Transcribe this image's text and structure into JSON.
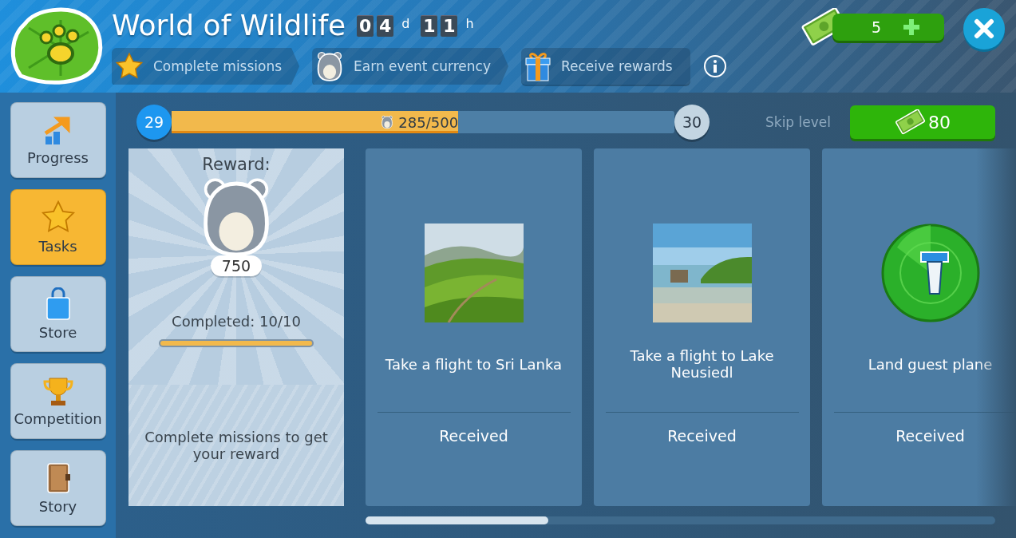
{
  "header": {
    "title": "World of Wildlife",
    "timer": [
      {
        "digits": [
          "0",
          "4"
        ],
        "unit": "d"
      },
      {
        "digits": [
          "1",
          "1"
        ],
        "unit": "h"
      }
    ],
    "steps": [
      {
        "kind": "star",
        "label": "Complete missions"
      },
      {
        "kind": "hamster",
        "label": "Earn event currency"
      },
      {
        "kind": "gift",
        "label": "Receive rewards"
      }
    ],
    "currency": {
      "amount": "5"
    }
  },
  "sidebar": {
    "items": [
      {
        "kind": "progress",
        "label": "Progress",
        "selected": false
      },
      {
        "kind": "star",
        "label": "Tasks",
        "selected": true
      },
      {
        "kind": "bag",
        "label": "Store",
        "selected": false
      },
      {
        "kind": "trophy",
        "label": "Competition",
        "selected": false
      },
      {
        "kind": "book",
        "label": "Story",
        "selected": false
      }
    ]
  },
  "progress": {
    "current_level": "29",
    "next_level": "30",
    "reading": "285/500",
    "level": 0.57
  },
  "skip": {
    "label": "Skip level",
    "price": "80"
  },
  "reward": {
    "title": "Reward:",
    "amount": "750",
    "completed": "Completed: 10/10",
    "level": 1,
    "hint": "Complete missions to get your reward"
  },
  "missions": [
    {
      "kind": "hills",
      "title": "Take a flight to Sri Lanka",
      "status": "Received"
    },
    {
      "kind": "lake",
      "title": "Take a flight to Lake Neusiedl",
      "status": "Received"
    },
    {
      "kind": "radar",
      "title": "Land guest plane",
      "status": "Received"
    }
  ]
}
